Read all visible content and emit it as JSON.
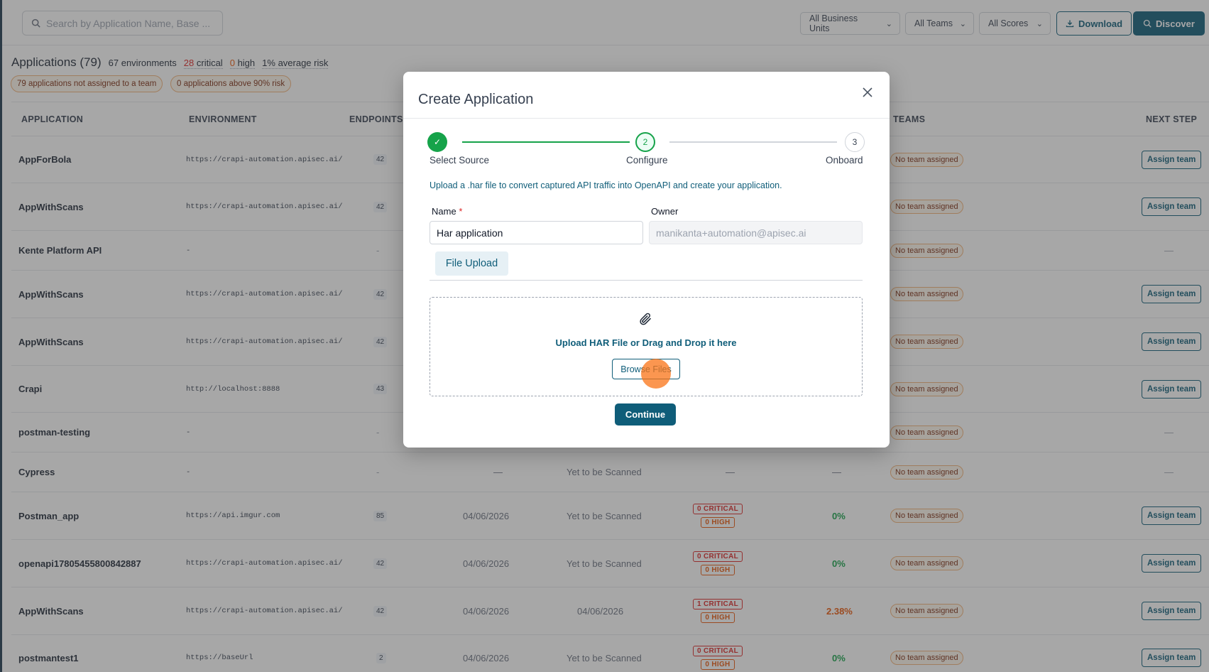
{
  "topbar": {
    "search_placeholder": "Search by Application Name, Base ...",
    "filters": [
      "All Business Units",
      "All Teams",
      "All Scores"
    ],
    "download_label": "Download",
    "discover_label": "Discover"
  },
  "summary": {
    "title": "Applications (79)",
    "environments_count": "67",
    "environments_label": "environments",
    "critical_count": "28",
    "critical_label": "critical",
    "high_count": "0",
    "high_label": "high",
    "avg_risk_value": "1%",
    "avg_risk_label": "average risk",
    "pill_unassigned": "79 applications not assigned to a team",
    "pill_above_risk": "0 applications above 90% risk"
  },
  "table": {
    "headers": {
      "application": "APPLICATION",
      "environment": "ENVIRONMENT",
      "endpoints": "ENDPOINTS",
      "teams": "TEAMS",
      "next_step": "NEXT STEP"
    },
    "no_team_label": "No team assigned",
    "assign_label": "Assign team",
    "rows": [
      {
        "name": "AppForBola",
        "env": "https://crapi-automation.apisec.ai/",
        "endpoints": "42",
        "date1": "",
        "date2": "",
        "crit": "",
        "high": "",
        "risk": "",
        "assign": true
      },
      {
        "name": "AppWithScans",
        "env": "https://crapi-automation.apisec.ai/",
        "endpoints": "42",
        "date1": "",
        "date2": "",
        "crit": "",
        "high": "",
        "risk": "",
        "assign": true
      },
      {
        "name": "Kente Platform API",
        "env": "-",
        "endpoints": "-",
        "date1": "",
        "date2": "",
        "crit": "",
        "high": "",
        "risk": "",
        "assign": false
      },
      {
        "name": "AppWithScans",
        "env": "https://crapi-automation.apisec.ai/",
        "endpoints": "42",
        "date1": "",
        "date2": "",
        "crit": "",
        "high": "",
        "risk": "",
        "assign": true
      },
      {
        "name": "AppWithScans",
        "env": "https://crapi-automation.apisec.ai/",
        "endpoints": "42",
        "date1": "",
        "date2": "",
        "crit": "",
        "high": "",
        "risk": "",
        "assign": true
      },
      {
        "name": "Crapi",
        "env": "http://localhost:8888",
        "endpoints": "43",
        "date1": "",
        "date2": "",
        "crit": "",
        "high": "",
        "risk": "",
        "assign": true
      },
      {
        "name": "postman-testing",
        "env": "-",
        "endpoints": "-",
        "date1": "",
        "date2": "",
        "crit": "",
        "high": "",
        "risk": "",
        "assign": false
      },
      {
        "name": "Cypress",
        "env": "-",
        "endpoints": "-",
        "date1": "—",
        "date2": "Yet to be Scanned",
        "crit": "",
        "high": "",
        "risk": "—",
        "assign": false
      },
      {
        "name": "Postman_app",
        "env": "https://api.imgur.com",
        "endpoints": "85",
        "date1": "04/06/2026",
        "date2": "Yet to be Scanned",
        "crit": "0 CRITICAL",
        "high": "0 HIGH",
        "risk": "0%",
        "assign": true
      },
      {
        "name": "openapi17805455800842887",
        "env": "https://crapi-automation.apisec.ai/",
        "endpoints": "42",
        "date1": "04/06/2026",
        "date2": "Yet to be Scanned",
        "crit": "0 CRITICAL",
        "high": "0 HIGH",
        "risk": "0%",
        "assign": true
      },
      {
        "name": "AppWithScans",
        "env": "https://crapi-automation.apisec.ai/",
        "endpoints": "42",
        "date1": "04/06/2026",
        "date2": "04/06/2026",
        "crit": "1 CRITICAL",
        "high": "0 HIGH",
        "risk": "2.38%",
        "assign": true
      },
      {
        "name": "postmantest1",
        "env": "https://baseUrl",
        "endpoints": "2",
        "date1": "04/06/2026",
        "date2": "Yet to be Scanned",
        "crit": "0 CRITICAL",
        "high": "0 HIGH",
        "risk": "0%",
        "assign": true
      }
    ]
  },
  "modal": {
    "title": "Create Application",
    "steps": [
      {
        "number": "1",
        "label": "Select Source",
        "state": "done"
      },
      {
        "number": "2",
        "label": "Configure",
        "state": "active"
      },
      {
        "number": "3",
        "label": "Onboard",
        "state": "idle"
      }
    ],
    "check_glyph": "✓",
    "description": "Upload a .har file to convert captured API traffic into OpenAPI and create your application.",
    "name_label": "Name",
    "required_mark": "*",
    "name_value": "Har application",
    "owner_label": "Owner",
    "owner_value": "manikanta+automation@apisec.ai",
    "tab_label": "File Upload",
    "drop_text": "Upload HAR File or Drag and Drop it here",
    "browse_label": "Browse Files",
    "continue_label": "Continue"
  },
  "colors": {
    "accent": "#0f5d79",
    "success": "#16a34a",
    "critical": "#dc2626",
    "high": "#ea580c",
    "overlay": "rgba(60,60,60,0.45)"
  },
  "icons": {
    "search": "search-icon",
    "chevron": "chevron-down-icon",
    "download": "download-icon",
    "close": "close-icon",
    "check": "check-icon",
    "attachment": "paperclip-icon"
  }
}
